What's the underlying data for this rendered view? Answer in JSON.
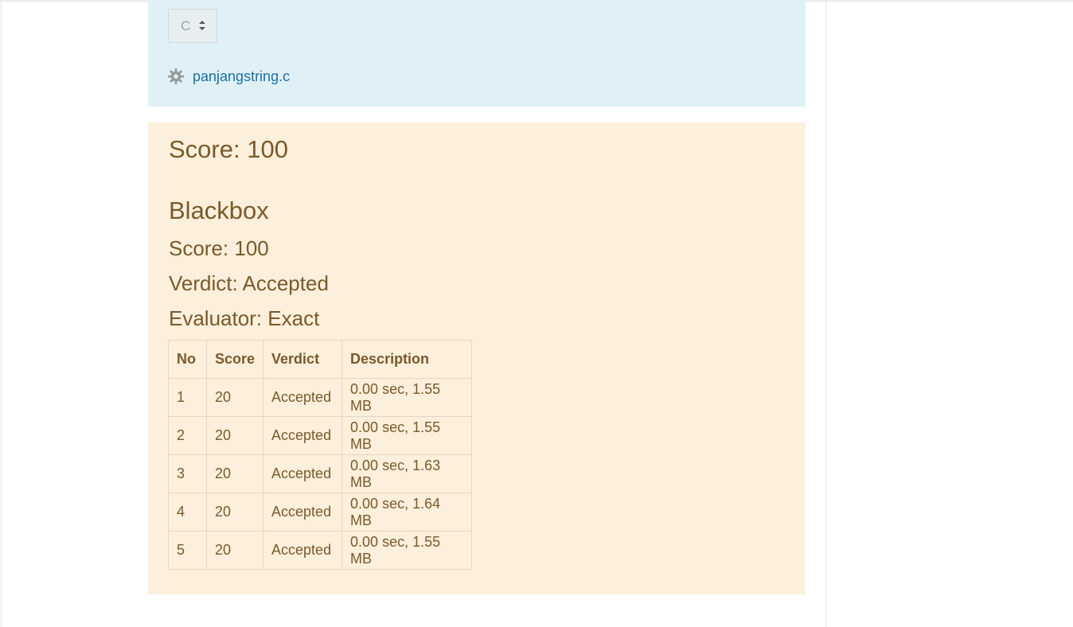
{
  "language_select": {
    "value": "C"
  },
  "file": {
    "name": "panjangstring.c",
    "icon": "gear-icon"
  },
  "overall": {
    "score_text": "Score: 100"
  },
  "section": {
    "title": "Blackbox",
    "score_text": "Score: 100",
    "verdict_text": "Verdict: Accepted",
    "evaluator_text": "Evaluator: Exact"
  },
  "table": {
    "headers": [
      "No",
      "Score",
      "Verdict",
      "Description"
    ],
    "rows": [
      [
        "1",
        "20",
        "Accepted",
        "0.00 sec, 1.55 MB"
      ],
      [
        "2",
        "20",
        "Accepted",
        "0.00 sec, 1.55 MB"
      ],
      [
        "3",
        "20",
        "Accepted",
        "0.00 sec, 1.63 MB"
      ],
      [
        "4",
        "20",
        "Accepted",
        "0.00 sec, 1.64 MB"
      ],
      [
        "5",
        "20",
        "Accepted",
        "0.00 sec, 1.55 MB"
      ]
    ]
  },
  "colors": {
    "info_bg": "#dff1f7",
    "result_bg": "#fcefdc",
    "result_text": "#7a5a2a",
    "link": "#1d6fa5"
  }
}
